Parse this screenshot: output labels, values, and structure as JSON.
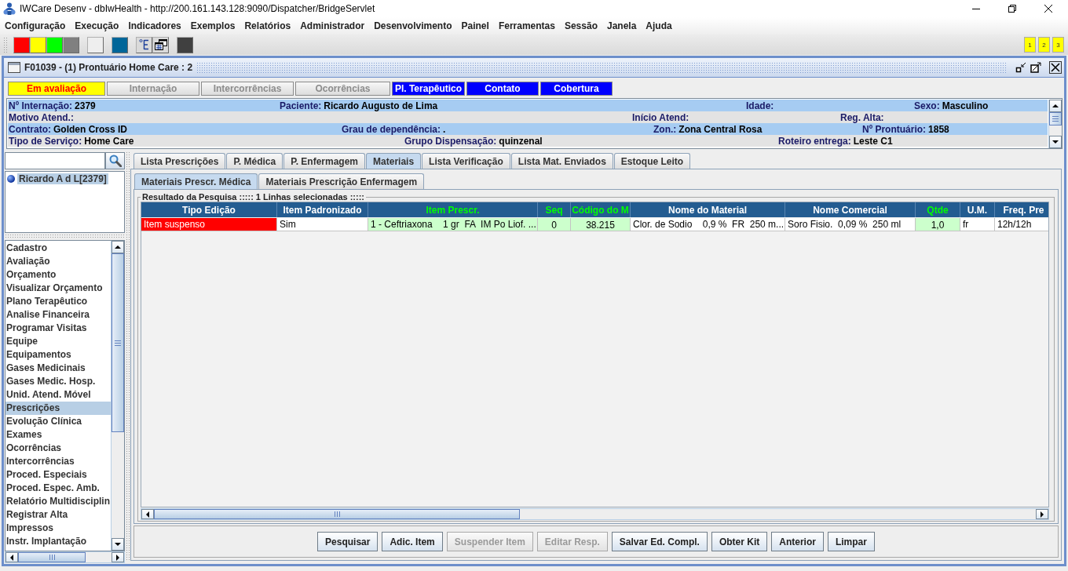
{
  "window": {
    "title": "IWCare Desenv - dbIwHealth - http://200.161.143.128:9090/Dispatcher/BridgeServlet"
  },
  "menu": [
    "Configuração",
    "Execução",
    "Indicadores",
    "Exemplos",
    "Relatórios",
    "Administrador",
    "Desenvolvimento",
    "Painel",
    "Ferramentas",
    "Sessão",
    "Janela",
    "Ajuda"
  ],
  "toolbar": {
    "groups": [
      [
        {
          "kind": "swatch",
          "color": "#ff0000"
        },
        {
          "kind": "swatch",
          "color": "#ffff00"
        },
        {
          "kind": "swatch",
          "color": "#00ff00"
        },
        {
          "kind": "swatch",
          "color": "#808080"
        }
      ],
      [
        {
          "kind": "swatch",
          "color": "#eeeeee"
        }
      ],
      [
        {
          "kind": "swatch",
          "color": "#006699"
        }
      ],
      [
        {
          "kind": "tree"
        },
        {
          "kind": "windows"
        }
      ],
      [
        {
          "kind": "swatch",
          "color": "#404040"
        }
      ]
    ],
    "quick_buttons": [
      "1",
      "2",
      "3"
    ]
  },
  "frame": {
    "title": "F01039 - (1) Prontuário Home Care : 2"
  },
  "status_buttons": [
    {
      "label": "Em avaliação",
      "disabled": false,
      "kind": "warning"
    },
    {
      "label": "Internação",
      "disabled": true
    },
    {
      "label": "Intercorrências",
      "disabled": true
    },
    {
      "label": "Ocorrências",
      "disabled": true
    },
    {
      "label": "Pl. Terapêutico",
      "disabled": false,
      "kind": "primary"
    },
    {
      "label": "Contato",
      "disabled": false,
      "kind": "primary"
    },
    {
      "label": "Cobertura",
      "disabled": false,
      "kind": "primary"
    }
  ],
  "patient_info": {
    "rows": [
      {
        "fields": [
          {
            "label": "Nº Internação:",
            "value": "2379"
          },
          {
            "label": "Paciente:",
            "value": "Ricardo Augusto de Lima"
          },
          {
            "label": "Idade:"
          },
          {
            "label": "Sexo:",
            "value": "Masculino"
          }
        ]
      },
      {
        "fields": [
          {
            "label": "Motivo Atend.:"
          },
          {
            "label": "Início Atend:"
          },
          {
            "label": "Reg. Alta:"
          }
        ]
      },
      {
        "fields": [
          {
            "label": "Contrato:",
            "value": "Golden Cross ID"
          },
          {
            "label": "Grau de dependência:",
            "value": "."
          },
          {
            "label": "Zon.:",
            "value": "Zona Central Rosa"
          },
          {
            "label": "Nº Prontuário:",
            "value": "1858"
          }
        ]
      },
      {
        "fields": [
          {
            "label": "Tipo de Serviço:",
            "value": "Home Care"
          },
          {
            "label": "Grupo Dispensação:",
            "value": "quinzenal"
          },
          {
            "label": "Roteiro entrega:",
            "value": "Leste C1"
          }
        ]
      }
    ]
  },
  "patient_tree": [
    {
      "label": "Ricardo A d L[2379]",
      "selected": true
    }
  ],
  "nav_items": [
    {
      "label": "Cadastro",
      "selected": false
    },
    {
      "label": "Avaliação",
      "selected": false
    },
    {
      "label": "Orçamento",
      "selected": false
    },
    {
      "label": "Visualizar Orçamento",
      "selected": false
    },
    {
      "label": "Plano Terapêutico",
      "selected": false
    },
    {
      "label": "Analise Financeira",
      "selected": false
    },
    {
      "label": "Programar Visitas",
      "selected": false
    },
    {
      "label": "Equipe",
      "selected": false
    },
    {
      "label": "Equipamentos",
      "selected": false
    },
    {
      "label": "Gases Medicinais",
      "selected": false
    },
    {
      "label": "Gases Medic. Hosp.",
      "selected": false
    },
    {
      "label": "Unid. Atend. Móvel",
      "selected": false
    },
    {
      "label": "Prescrições",
      "selected": true
    },
    {
      "label": "Evolução Clínica",
      "selected": false
    },
    {
      "label": "Exames",
      "selected": false
    },
    {
      "label": "Ocorrências",
      "selected": false
    },
    {
      "label": "Intercorrências",
      "selected": false
    },
    {
      "label": "Proced. Especiais",
      "selected": false
    },
    {
      "label": "Proced. Espec. Amb.",
      "selected": false
    },
    {
      "label": "Relatório Multidisciplin",
      "selected": false
    },
    {
      "label": "Registrar Alta",
      "selected": false
    },
    {
      "label": "Impressos",
      "selected": false
    },
    {
      "label": "Instr. Implantação",
      "selected": false
    }
  ],
  "tabs": [
    {
      "label": "Lista Prescrições",
      "selected": false
    },
    {
      "label": "P. Médica",
      "selected": false
    },
    {
      "label": "P. Enfermagem",
      "selected": false
    },
    {
      "label": "Materiais",
      "selected": true
    },
    {
      "label": "Lista Verificação",
      "selected": false
    },
    {
      "label": "Lista Mat. Enviados",
      "selected": false
    },
    {
      "label": "Estoque Leito",
      "selected": false
    }
  ],
  "subtabs": [
    {
      "label": "Materiais Prescr. Médica",
      "selected": true
    },
    {
      "label": "Materiais Prescrição Enfermagem",
      "selected": false
    }
  ],
  "results": {
    "title": "Resultado da Pesquisa ::::: 1 Linhas selecionadas :::::",
    "table": {
      "columns": [
        {
          "label": "Tipo Edição",
          "highlighted": false
        },
        {
          "label": "Item Padronizado",
          "highlighted": false
        },
        {
          "label": "Item Prescr.",
          "highlighted": true
        },
        {
          "label": "Seq",
          "highlighted": true
        },
        {
          "label": "Código do M",
          "highlighted": true
        },
        {
          "label": "Nome do Material",
          "highlighted": false
        },
        {
          "label": "Nome Comercial",
          "highlighted": false
        },
        {
          "label": "Qtde",
          "highlighted": true
        },
        {
          "label": "U.M.",
          "highlighted": false
        },
        {
          "label": "Freq. Pre",
          "highlighted": false
        }
      ],
      "rows": [
        {
          "cells": [
            {
              "text": "Item suspenso",
              "color": "#ff0000"
            },
            {
              "text": "Sim",
              "color": "#ffffff"
            },
            {
              "text": "1 - Ceftriaxona    1 gr  FA  IM Po Liof. ...",
              "color": "#ccffcc"
            },
            {
              "text": "0",
              "color": "#ccffcc"
            },
            {
              "text": "38.215",
              "color": "#ccffcc"
            },
            {
              "text": "Clor. de Sodio    0,9 %  FR  250 m...",
              "color": "#ffffff"
            },
            {
              "text": "Soro Fisio.  0,09 %  250 ml",
              "color": "#ffffff"
            },
            {
              "text": "1,0",
              "color": "#ccffcc"
            },
            {
              "text": "fr",
              "color": "#ffffff"
            },
            {
              "text": "12h/12h",
              "color": "#ffffff"
            }
          ]
        }
      ]
    }
  },
  "buttons": [
    {
      "label": "Pesquisar",
      "disabled": false
    },
    {
      "label": "Adic. Item",
      "disabled": false
    },
    {
      "label": "Suspender Item",
      "disabled": true
    },
    {
      "label": "Editar Resp.",
      "disabled": true
    },
    {
      "label": "Salvar Ed. Compl.",
      "disabled": false
    },
    {
      "label": "Obter Kit",
      "disabled": false
    },
    {
      "label": "Anterior",
      "disabled": false
    },
    {
      "label": "Limpar",
      "disabled": false
    }
  ]
}
